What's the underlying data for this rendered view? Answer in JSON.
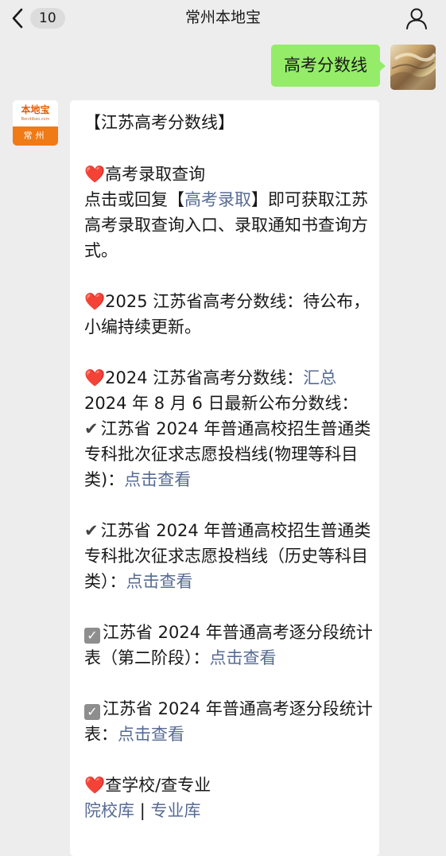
{
  "header": {
    "back_count": "10",
    "title": "常州本地宝",
    "back_icon": "chevron-left-icon",
    "user_icon": "person-icon"
  },
  "outgoing": {
    "text": "高考分数线"
  },
  "sender": {
    "logo_title": "本地宝",
    "logo_site": "Bendibao.com",
    "logo_city": "常州"
  },
  "message": {
    "title": "【江苏高考分数线】",
    "sections": {
      "query": {
        "heading": "高考录取查询",
        "text_prefix": "点击或回复【",
        "link": "高考录取",
        "text_suffix": "】即可获取江苏高考录取查询入口、录取通知书查询方式。"
      },
      "y2025": {
        "text": "2025 江苏省高考分数线：待公布，小编持续更新。"
      },
      "y2024": {
        "heading": "2024 江苏省高考分数线：",
        "heading_link": "汇总",
        "subline": "2024 年 8 月 6 日最新公布分数线："
      },
      "item1": {
        "text": "江苏省 2024 年普通高校招生普通类专科批次征求志愿投档线(物理等科目类)：",
        "link": "点击查看"
      },
      "item2": {
        "text": "江苏省 2024 年普通高校招生普通类专科批次征求志愿投档线（历史等科目类）：",
        "link": "点击查看"
      },
      "item3": {
        "text": "江苏省 2024 年普通高考逐分段统计表（第二阶段）：",
        "link": "点击查看"
      },
      "item4": {
        "text": "江苏省 2024 年普通高考逐分段统计表：",
        "link": "点击查看"
      },
      "school": {
        "heading": "查学校/查专业",
        "link1": "院校库",
        "separator": "|",
        "link2": "专业库"
      }
    }
  },
  "colors": {
    "background": "#ededed",
    "outgoing_bubble": "#95ec69",
    "link": "#576b95",
    "logo_orange": "#f07a16"
  }
}
